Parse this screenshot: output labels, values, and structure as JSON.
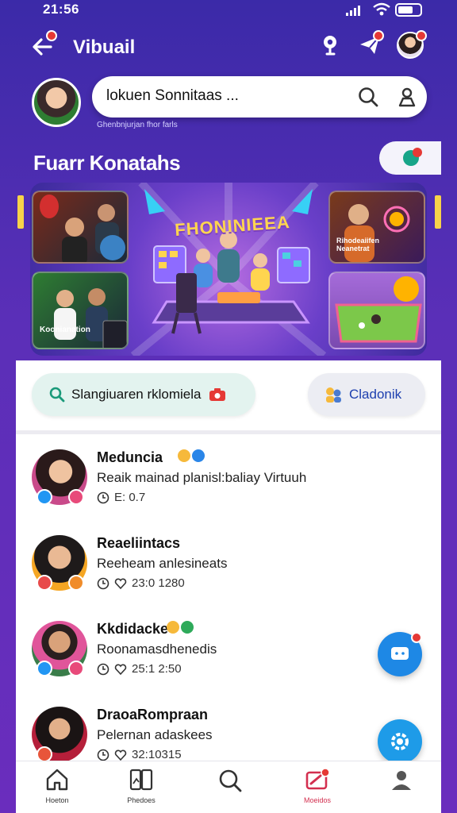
{
  "status": {
    "time": "21:56"
  },
  "header": {
    "title": "Vibuail"
  },
  "search": {
    "placeholder": "lokuen Sonnitaas ...",
    "caption": "Ghenbnjurjan fhor farls"
  },
  "section": {
    "title": "Fuarr Konatahs"
  },
  "banner": {
    "headline": "FHONINIEEA",
    "tile_left_bottom": "Koonianation",
    "tile_right_top": "Rihodeaiifen Neanetrat"
  },
  "chips": {
    "primary": "Slangiuaren rklomiela",
    "secondary": "Cladonik"
  },
  "conversations": [
    {
      "name": "Meduncia",
      "desc": "Reaik mainad planisl:baliay Virtuuh",
      "meta": "E: 0.7"
    },
    {
      "name": "Reaeliintacs",
      "desc": "Reeheam anlesineats",
      "meta": "23:0 1280"
    },
    {
      "name": "Kkdidacke",
      "desc": "Roonamasdhenedis",
      "meta": "25:1 2:50"
    },
    {
      "name": "DraoaRompraan",
      "desc": "Pelernan adaskees",
      "meta": "32:10315"
    }
  ],
  "nav": [
    {
      "label": "Hoeton"
    },
    {
      "label": "Phedoes"
    },
    {
      "label": ""
    },
    {
      "label": "Moeidos"
    },
    {
      "label": ""
    }
  ],
  "colors": {
    "accent": "#5b2fb8",
    "notification": "#e53935",
    "fab": "#1e88e5",
    "active_nav": "#d32f4f"
  }
}
